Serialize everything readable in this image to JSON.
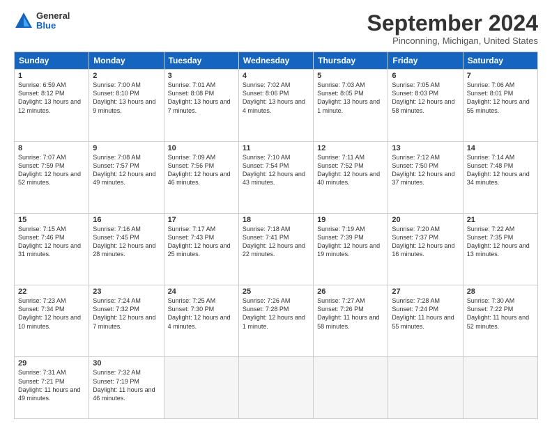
{
  "header": {
    "logo_general": "General",
    "logo_blue": "Blue",
    "title": "September 2024",
    "location": "Pinconning, Michigan, United States"
  },
  "weekdays": [
    "Sunday",
    "Monday",
    "Tuesday",
    "Wednesday",
    "Thursday",
    "Friday",
    "Saturday"
  ],
  "weeks": [
    [
      {
        "day": "1",
        "sunrise": "Sunrise: 6:59 AM",
        "sunset": "Sunset: 8:12 PM",
        "daylight": "Daylight: 13 hours and 12 minutes."
      },
      {
        "day": "2",
        "sunrise": "Sunrise: 7:00 AM",
        "sunset": "Sunset: 8:10 PM",
        "daylight": "Daylight: 13 hours and 9 minutes."
      },
      {
        "day": "3",
        "sunrise": "Sunrise: 7:01 AM",
        "sunset": "Sunset: 8:08 PM",
        "daylight": "Daylight: 13 hours and 7 minutes."
      },
      {
        "day": "4",
        "sunrise": "Sunrise: 7:02 AM",
        "sunset": "Sunset: 8:06 PM",
        "daylight": "Daylight: 13 hours and 4 minutes."
      },
      {
        "day": "5",
        "sunrise": "Sunrise: 7:03 AM",
        "sunset": "Sunset: 8:05 PM",
        "daylight": "Daylight: 13 hours and 1 minute."
      },
      {
        "day": "6",
        "sunrise": "Sunrise: 7:05 AM",
        "sunset": "Sunset: 8:03 PM",
        "daylight": "Daylight: 12 hours and 58 minutes."
      },
      {
        "day": "7",
        "sunrise": "Sunrise: 7:06 AM",
        "sunset": "Sunset: 8:01 PM",
        "daylight": "Daylight: 12 hours and 55 minutes."
      }
    ],
    [
      {
        "day": "8",
        "sunrise": "Sunrise: 7:07 AM",
        "sunset": "Sunset: 7:59 PM",
        "daylight": "Daylight: 12 hours and 52 minutes."
      },
      {
        "day": "9",
        "sunrise": "Sunrise: 7:08 AM",
        "sunset": "Sunset: 7:57 PM",
        "daylight": "Daylight: 12 hours and 49 minutes."
      },
      {
        "day": "10",
        "sunrise": "Sunrise: 7:09 AM",
        "sunset": "Sunset: 7:56 PM",
        "daylight": "Daylight: 12 hours and 46 minutes."
      },
      {
        "day": "11",
        "sunrise": "Sunrise: 7:10 AM",
        "sunset": "Sunset: 7:54 PM",
        "daylight": "Daylight: 12 hours and 43 minutes."
      },
      {
        "day": "12",
        "sunrise": "Sunrise: 7:11 AM",
        "sunset": "Sunset: 7:52 PM",
        "daylight": "Daylight: 12 hours and 40 minutes."
      },
      {
        "day": "13",
        "sunrise": "Sunrise: 7:12 AM",
        "sunset": "Sunset: 7:50 PM",
        "daylight": "Daylight: 12 hours and 37 minutes."
      },
      {
        "day": "14",
        "sunrise": "Sunrise: 7:14 AM",
        "sunset": "Sunset: 7:48 PM",
        "daylight": "Daylight: 12 hours and 34 minutes."
      }
    ],
    [
      {
        "day": "15",
        "sunrise": "Sunrise: 7:15 AM",
        "sunset": "Sunset: 7:46 PM",
        "daylight": "Daylight: 12 hours and 31 minutes."
      },
      {
        "day": "16",
        "sunrise": "Sunrise: 7:16 AM",
        "sunset": "Sunset: 7:45 PM",
        "daylight": "Daylight: 12 hours and 28 minutes."
      },
      {
        "day": "17",
        "sunrise": "Sunrise: 7:17 AM",
        "sunset": "Sunset: 7:43 PM",
        "daylight": "Daylight: 12 hours and 25 minutes."
      },
      {
        "day": "18",
        "sunrise": "Sunrise: 7:18 AM",
        "sunset": "Sunset: 7:41 PM",
        "daylight": "Daylight: 12 hours and 22 minutes."
      },
      {
        "day": "19",
        "sunrise": "Sunrise: 7:19 AM",
        "sunset": "Sunset: 7:39 PM",
        "daylight": "Daylight: 12 hours and 19 minutes."
      },
      {
        "day": "20",
        "sunrise": "Sunrise: 7:20 AM",
        "sunset": "Sunset: 7:37 PM",
        "daylight": "Daylight: 12 hours and 16 minutes."
      },
      {
        "day": "21",
        "sunrise": "Sunrise: 7:22 AM",
        "sunset": "Sunset: 7:35 PM",
        "daylight": "Daylight: 12 hours and 13 minutes."
      }
    ],
    [
      {
        "day": "22",
        "sunrise": "Sunrise: 7:23 AM",
        "sunset": "Sunset: 7:34 PM",
        "daylight": "Daylight: 12 hours and 10 minutes."
      },
      {
        "day": "23",
        "sunrise": "Sunrise: 7:24 AM",
        "sunset": "Sunset: 7:32 PM",
        "daylight": "Daylight: 12 hours and 7 minutes."
      },
      {
        "day": "24",
        "sunrise": "Sunrise: 7:25 AM",
        "sunset": "Sunset: 7:30 PM",
        "daylight": "Daylight: 12 hours and 4 minutes."
      },
      {
        "day": "25",
        "sunrise": "Sunrise: 7:26 AM",
        "sunset": "Sunset: 7:28 PM",
        "daylight": "Daylight: 12 hours and 1 minute."
      },
      {
        "day": "26",
        "sunrise": "Sunrise: 7:27 AM",
        "sunset": "Sunset: 7:26 PM",
        "daylight": "Daylight: 11 hours and 58 minutes."
      },
      {
        "day": "27",
        "sunrise": "Sunrise: 7:28 AM",
        "sunset": "Sunset: 7:24 PM",
        "daylight": "Daylight: 11 hours and 55 minutes."
      },
      {
        "day": "28",
        "sunrise": "Sunrise: 7:30 AM",
        "sunset": "Sunset: 7:22 PM",
        "daylight": "Daylight: 11 hours and 52 minutes."
      }
    ],
    [
      {
        "day": "29",
        "sunrise": "Sunrise: 7:31 AM",
        "sunset": "Sunset: 7:21 PM",
        "daylight": "Daylight: 11 hours and 49 minutes."
      },
      {
        "day": "30",
        "sunrise": "Sunrise: 7:32 AM",
        "sunset": "Sunset: 7:19 PM",
        "daylight": "Daylight: 11 hours and 46 minutes."
      },
      null,
      null,
      null,
      null,
      null
    ]
  ]
}
